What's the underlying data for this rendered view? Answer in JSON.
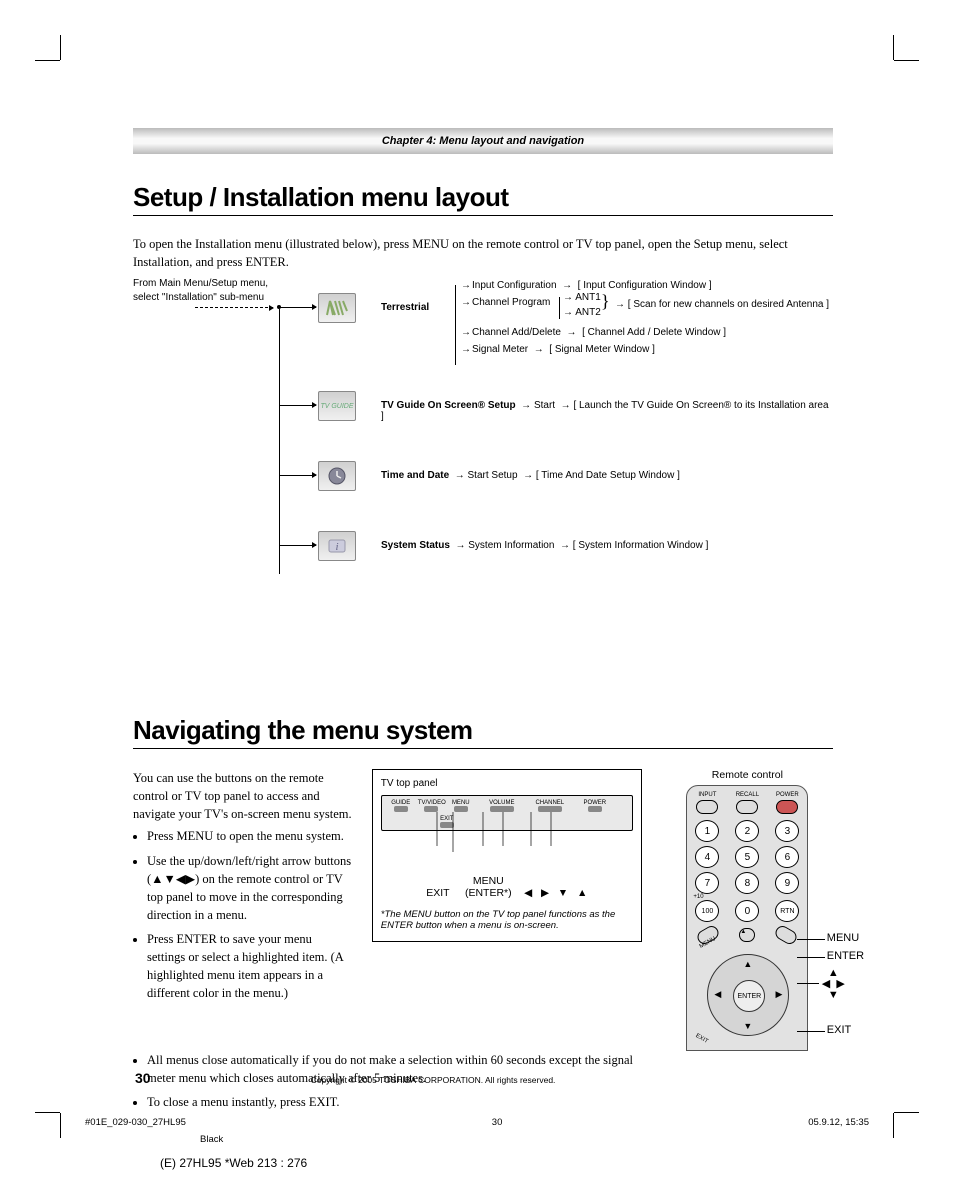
{
  "chapter_heading": "Chapter 4: Menu layout and navigation",
  "section1": {
    "title": "Setup / Installation menu layout",
    "intro": "To open the Installation menu (illustrated below), press MENU on the remote control or TV top panel, open the Setup menu, select Installation, and press ENTER."
  },
  "diagram": {
    "from_text": "From Main Menu/Setup menu, select \"Installation\" sub-menu",
    "terrestrial": {
      "label": "Terrestrial",
      "items": {
        "input_config": "Input Configuration",
        "input_config_win": "[ Input Configuration Window ]",
        "channel_program": "Channel Program",
        "ant1": "ANT1",
        "ant2": "ANT2",
        "scan_note": "[ Scan for new channels on desired Antenna ]",
        "channel_add": "Channel Add/Delete",
        "channel_add_win": "[ Channel Add / Delete Window ]",
        "signal_meter": "Signal Meter",
        "signal_meter_win": "[ Signal Meter Window ]"
      }
    },
    "tvguide": {
      "label": "TV Guide On Screen® Setup",
      "start": "Start",
      "result": "[ Launch the TV Guide On Screen® to its Installation area ]"
    },
    "time": {
      "label": "Time and Date",
      "start": "Start Setup",
      "result": "[ Time And Date Setup Window ]"
    },
    "system": {
      "label": "System Status",
      "start": "System Information",
      "result": "[ System Information Window ]"
    },
    "icon_tvguide": "TV GUIDE"
  },
  "section2": {
    "title": "Navigating the menu system",
    "intro": "You can use the buttons on the remote control or TV top panel to access and navigate your TV's on-screen menu system.",
    "bullets": [
      "Press MENU to open the menu system.",
      "Use the up/down/left/right arrow buttons (▲▼◀▶) on the remote control or TV top panel to move in the corresponding direction in a menu.",
      "Press ENTER to save your menu settings or select a highlighted item. (A highlighted menu item appears in a different color in the menu.)"
    ],
    "lower_bullets": [
      "All menus close automatically if you do not make a selection within 60 seconds except the signal meter menu which closes automatically after 5 minutes.",
      "To close a menu instantly, press EXIT."
    ]
  },
  "tvpanel": {
    "title": "TV top panel",
    "buttons": [
      "GUIDE",
      "TV/VIDEO",
      "MENU",
      "VOLUME",
      "CHANNEL",
      "POWER"
    ],
    "exit_btn": "EXIT",
    "callout_exit": "EXIT",
    "callout_menu": "MENU (ENTER*)",
    "note": "*The MENU button on the TV top panel functions as the ENTER button when a menu is on-screen."
  },
  "remote": {
    "title": "Remote control",
    "top_labels": [
      "INPUT",
      "RECALL",
      "POWER"
    ],
    "digits": [
      "1",
      "2",
      "3",
      "4",
      "5",
      "6",
      "7",
      "8",
      "9",
      "100",
      "0",
      "RTN"
    ],
    "plus10": "+10",
    "enter": "ENTER",
    "side_menu": "MENU",
    "side_exit": "EXIT",
    "annot_menu": "MENU",
    "annot_enter": "ENTER",
    "annot_exit": "EXIT",
    "dpad_arrows": "▲ ◀ ▶ ▼"
  },
  "footer": {
    "page": "30",
    "copyright": "Copyright © 2005 TOSHIBA CORPORATION. All rights reserved.",
    "meta_left": "#01E_029-030_27HL95",
    "meta_mid": "30",
    "meta_right": "05.9.12, 15:35",
    "meta_black": "Black",
    "watermark": "(E) 27HL95 *Web 213 : 276"
  }
}
